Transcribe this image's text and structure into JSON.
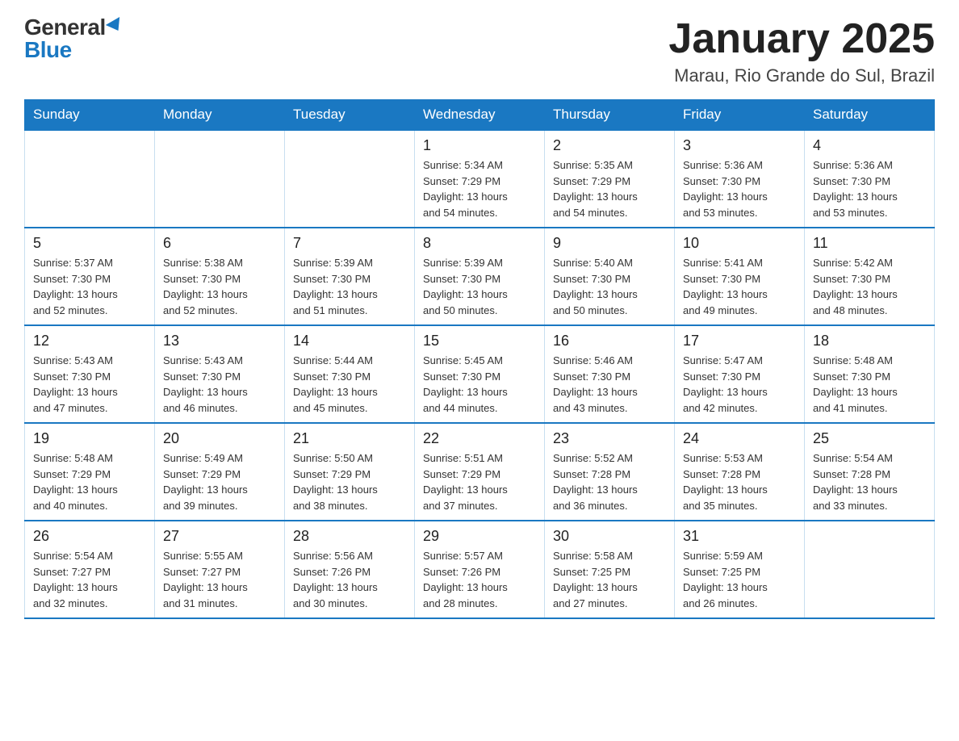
{
  "header": {
    "logo_general": "General",
    "logo_blue": "Blue",
    "month_title": "January 2025",
    "location": "Marau, Rio Grande do Sul, Brazil"
  },
  "days_of_week": [
    "Sunday",
    "Monday",
    "Tuesday",
    "Wednesday",
    "Thursday",
    "Friday",
    "Saturday"
  ],
  "weeks": [
    [
      {
        "day": "",
        "info": ""
      },
      {
        "day": "",
        "info": ""
      },
      {
        "day": "",
        "info": ""
      },
      {
        "day": "1",
        "info": "Sunrise: 5:34 AM\nSunset: 7:29 PM\nDaylight: 13 hours\nand 54 minutes."
      },
      {
        "day": "2",
        "info": "Sunrise: 5:35 AM\nSunset: 7:29 PM\nDaylight: 13 hours\nand 54 minutes."
      },
      {
        "day": "3",
        "info": "Sunrise: 5:36 AM\nSunset: 7:30 PM\nDaylight: 13 hours\nand 53 minutes."
      },
      {
        "day": "4",
        "info": "Sunrise: 5:36 AM\nSunset: 7:30 PM\nDaylight: 13 hours\nand 53 minutes."
      }
    ],
    [
      {
        "day": "5",
        "info": "Sunrise: 5:37 AM\nSunset: 7:30 PM\nDaylight: 13 hours\nand 52 minutes."
      },
      {
        "day": "6",
        "info": "Sunrise: 5:38 AM\nSunset: 7:30 PM\nDaylight: 13 hours\nand 52 minutes."
      },
      {
        "day": "7",
        "info": "Sunrise: 5:39 AM\nSunset: 7:30 PM\nDaylight: 13 hours\nand 51 minutes."
      },
      {
        "day": "8",
        "info": "Sunrise: 5:39 AM\nSunset: 7:30 PM\nDaylight: 13 hours\nand 50 minutes."
      },
      {
        "day": "9",
        "info": "Sunrise: 5:40 AM\nSunset: 7:30 PM\nDaylight: 13 hours\nand 50 minutes."
      },
      {
        "day": "10",
        "info": "Sunrise: 5:41 AM\nSunset: 7:30 PM\nDaylight: 13 hours\nand 49 minutes."
      },
      {
        "day": "11",
        "info": "Sunrise: 5:42 AM\nSunset: 7:30 PM\nDaylight: 13 hours\nand 48 minutes."
      }
    ],
    [
      {
        "day": "12",
        "info": "Sunrise: 5:43 AM\nSunset: 7:30 PM\nDaylight: 13 hours\nand 47 minutes."
      },
      {
        "day": "13",
        "info": "Sunrise: 5:43 AM\nSunset: 7:30 PM\nDaylight: 13 hours\nand 46 minutes."
      },
      {
        "day": "14",
        "info": "Sunrise: 5:44 AM\nSunset: 7:30 PM\nDaylight: 13 hours\nand 45 minutes."
      },
      {
        "day": "15",
        "info": "Sunrise: 5:45 AM\nSunset: 7:30 PM\nDaylight: 13 hours\nand 44 minutes."
      },
      {
        "day": "16",
        "info": "Sunrise: 5:46 AM\nSunset: 7:30 PM\nDaylight: 13 hours\nand 43 minutes."
      },
      {
        "day": "17",
        "info": "Sunrise: 5:47 AM\nSunset: 7:30 PM\nDaylight: 13 hours\nand 42 minutes."
      },
      {
        "day": "18",
        "info": "Sunrise: 5:48 AM\nSunset: 7:30 PM\nDaylight: 13 hours\nand 41 minutes."
      }
    ],
    [
      {
        "day": "19",
        "info": "Sunrise: 5:48 AM\nSunset: 7:29 PM\nDaylight: 13 hours\nand 40 minutes."
      },
      {
        "day": "20",
        "info": "Sunrise: 5:49 AM\nSunset: 7:29 PM\nDaylight: 13 hours\nand 39 minutes."
      },
      {
        "day": "21",
        "info": "Sunrise: 5:50 AM\nSunset: 7:29 PM\nDaylight: 13 hours\nand 38 minutes."
      },
      {
        "day": "22",
        "info": "Sunrise: 5:51 AM\nSunset: 7:29 PM\nDaylight: 13 hours\nand 37 minutes."
      },
      {
        "day": "23",
        "info": "Sunrise: 5:52 AM\nSunset: 7:28 PM\nDaylight: 13 hours\nand 36 minutes."
      },
      {
        "day": "24",
        "info": "Sunrise: 5:53 AM\nSunset: 7:28 PM\nDaylight: 13 hours\nand 35 minutes."
      },
      {
        "day": "25",
        "info": "Sunrise: 5:54 AM\nSunset: 7:28 PM\nDaylight: 13 hours\nand 33 minutes."
      }
    ],
    [
      {
        "day": "26",
        "info": "Sunrise: 5:54 AM\nSunset: 7:27 PM\nDaylight: 13 hours\nand 32 minutes."
      },
      {
        "day": "27",
        "info": "Sunrise: 5:55 AM\nSunset: 7:27 PM\nDaylight: 13 hours\nand 31 minutes."
      },
      {
        "day": "28",
        "info": "Sunrise: 5:56 AM\nSunset: 7:26 PM\nDaylight: 13 hours\nand 30 minutes."
      },
      {
        "day": "29",
        "info": "Sunrise: 5:57 AM\nSunset: 7:26 PM\nDaylight: 13 hours\nand 28 minutes."
      },
      {
        "day": "30",
        "info": "Sunrise: 5:58 AM\nSunset: 7:25 PM\nDaylight: 13 hours\nand 27 minutes."
      },
      {
        "day": "31",
        "info": "Sunrise: 5:59 AM\nSunset: 7:25 PM\nDaylight: 13 hours\nand 26 minutes."
      },
      {
        "day": "",
        "info": ""
      }
    ]
  ]
}
